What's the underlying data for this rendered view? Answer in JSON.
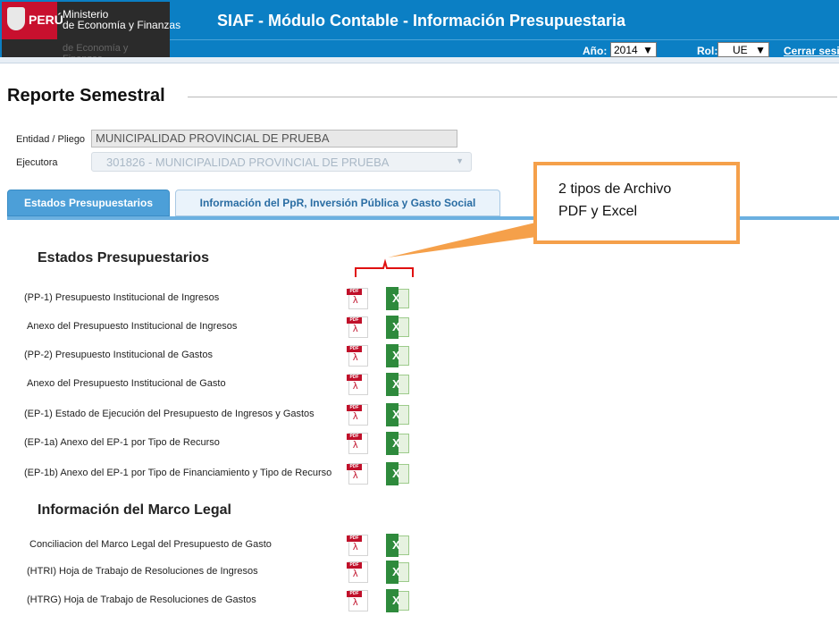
{
  "header": {
    "logo": {
      "country": "PERÚ",
      "line1": "Ministerio",
      "line2": "de Economía y Finanzas",
      "faded": "de Economía y Finanzas"
    },
    "app_title": "SIAF - Módulo Contable - Información Presupuestaria",
    "year_label": "Año:",
    "year_value": "2014",
    "role_label": "Rol:",
    "role_value": "UE",
    "logout": "Cerrar sesión",
    "colors": {
      "header_bg": "#0b7fc4"
    }
  },
  "page": {
    "title": "Reporte Semestral",
    "entidad_label": "Entidad / Pliego",
    "entidad_value": "MUNICIPALIDAD PROVINCIAL DE  PRUEBA",
    "ejecutora_label": "Ejecutora",
    "ejecutora_value": "301826 - MUNICIPALIDAD PROVINCIAL DE  PRUEBA"
  },
  "tabs": [
    {
      "label": "Estados Presupuestarios",
      "active": true
    },
    {
      "label": "Información del PpR, Inversión Pública y Gasto Social",
      "active": false
    }
  ],
  "sections": {
    "estados": {
      "title": "Estados Presupuestarios",
      "reports": [
        "(PP-1) Presupuesto Institucional de Ingresos",
        "Anexo del Presupuesto Institucional de Ingresos",
        "(PP-2) Presupuesto Institucional de Gastos",
        "Anexo del Presupuesto Institucional de Gasto",
        "(EP-1) Estado de Ejecución del Presupuesto de Ingresos y Gastos",
        "(EP-1a) Anexo del EP-1 por Tipo de Recurso",
        "(EP-1b) Anexo del EP-1 por Tipo de Financiamiento y Tipo de Recurso"
      ]
    },
    "marco": {
      "title": "Información del Marco Legal",
      "reports": [
        "Conciliacion del Marco Legal del Presupuesto de Gasto",
        "(HTRI) Hoja de Trabajo de Resoluciones de Ingresos",
        "(HTRG) Hoja de Trabajo de Resoluciones de Gastos"
      ]
    }
  },
  "icons": {
    "pdf": "pdf-icon",
    "excel": "excel-icon",
    "pdf_mark": "Adobe",
    "pdf_badge": "PDF"
  },
  "callout": {
    "line1": "2 tipos de Archivo",
    "line2": "PDF y Excel",
    "border_color": "#f5a04a"
  }
}
